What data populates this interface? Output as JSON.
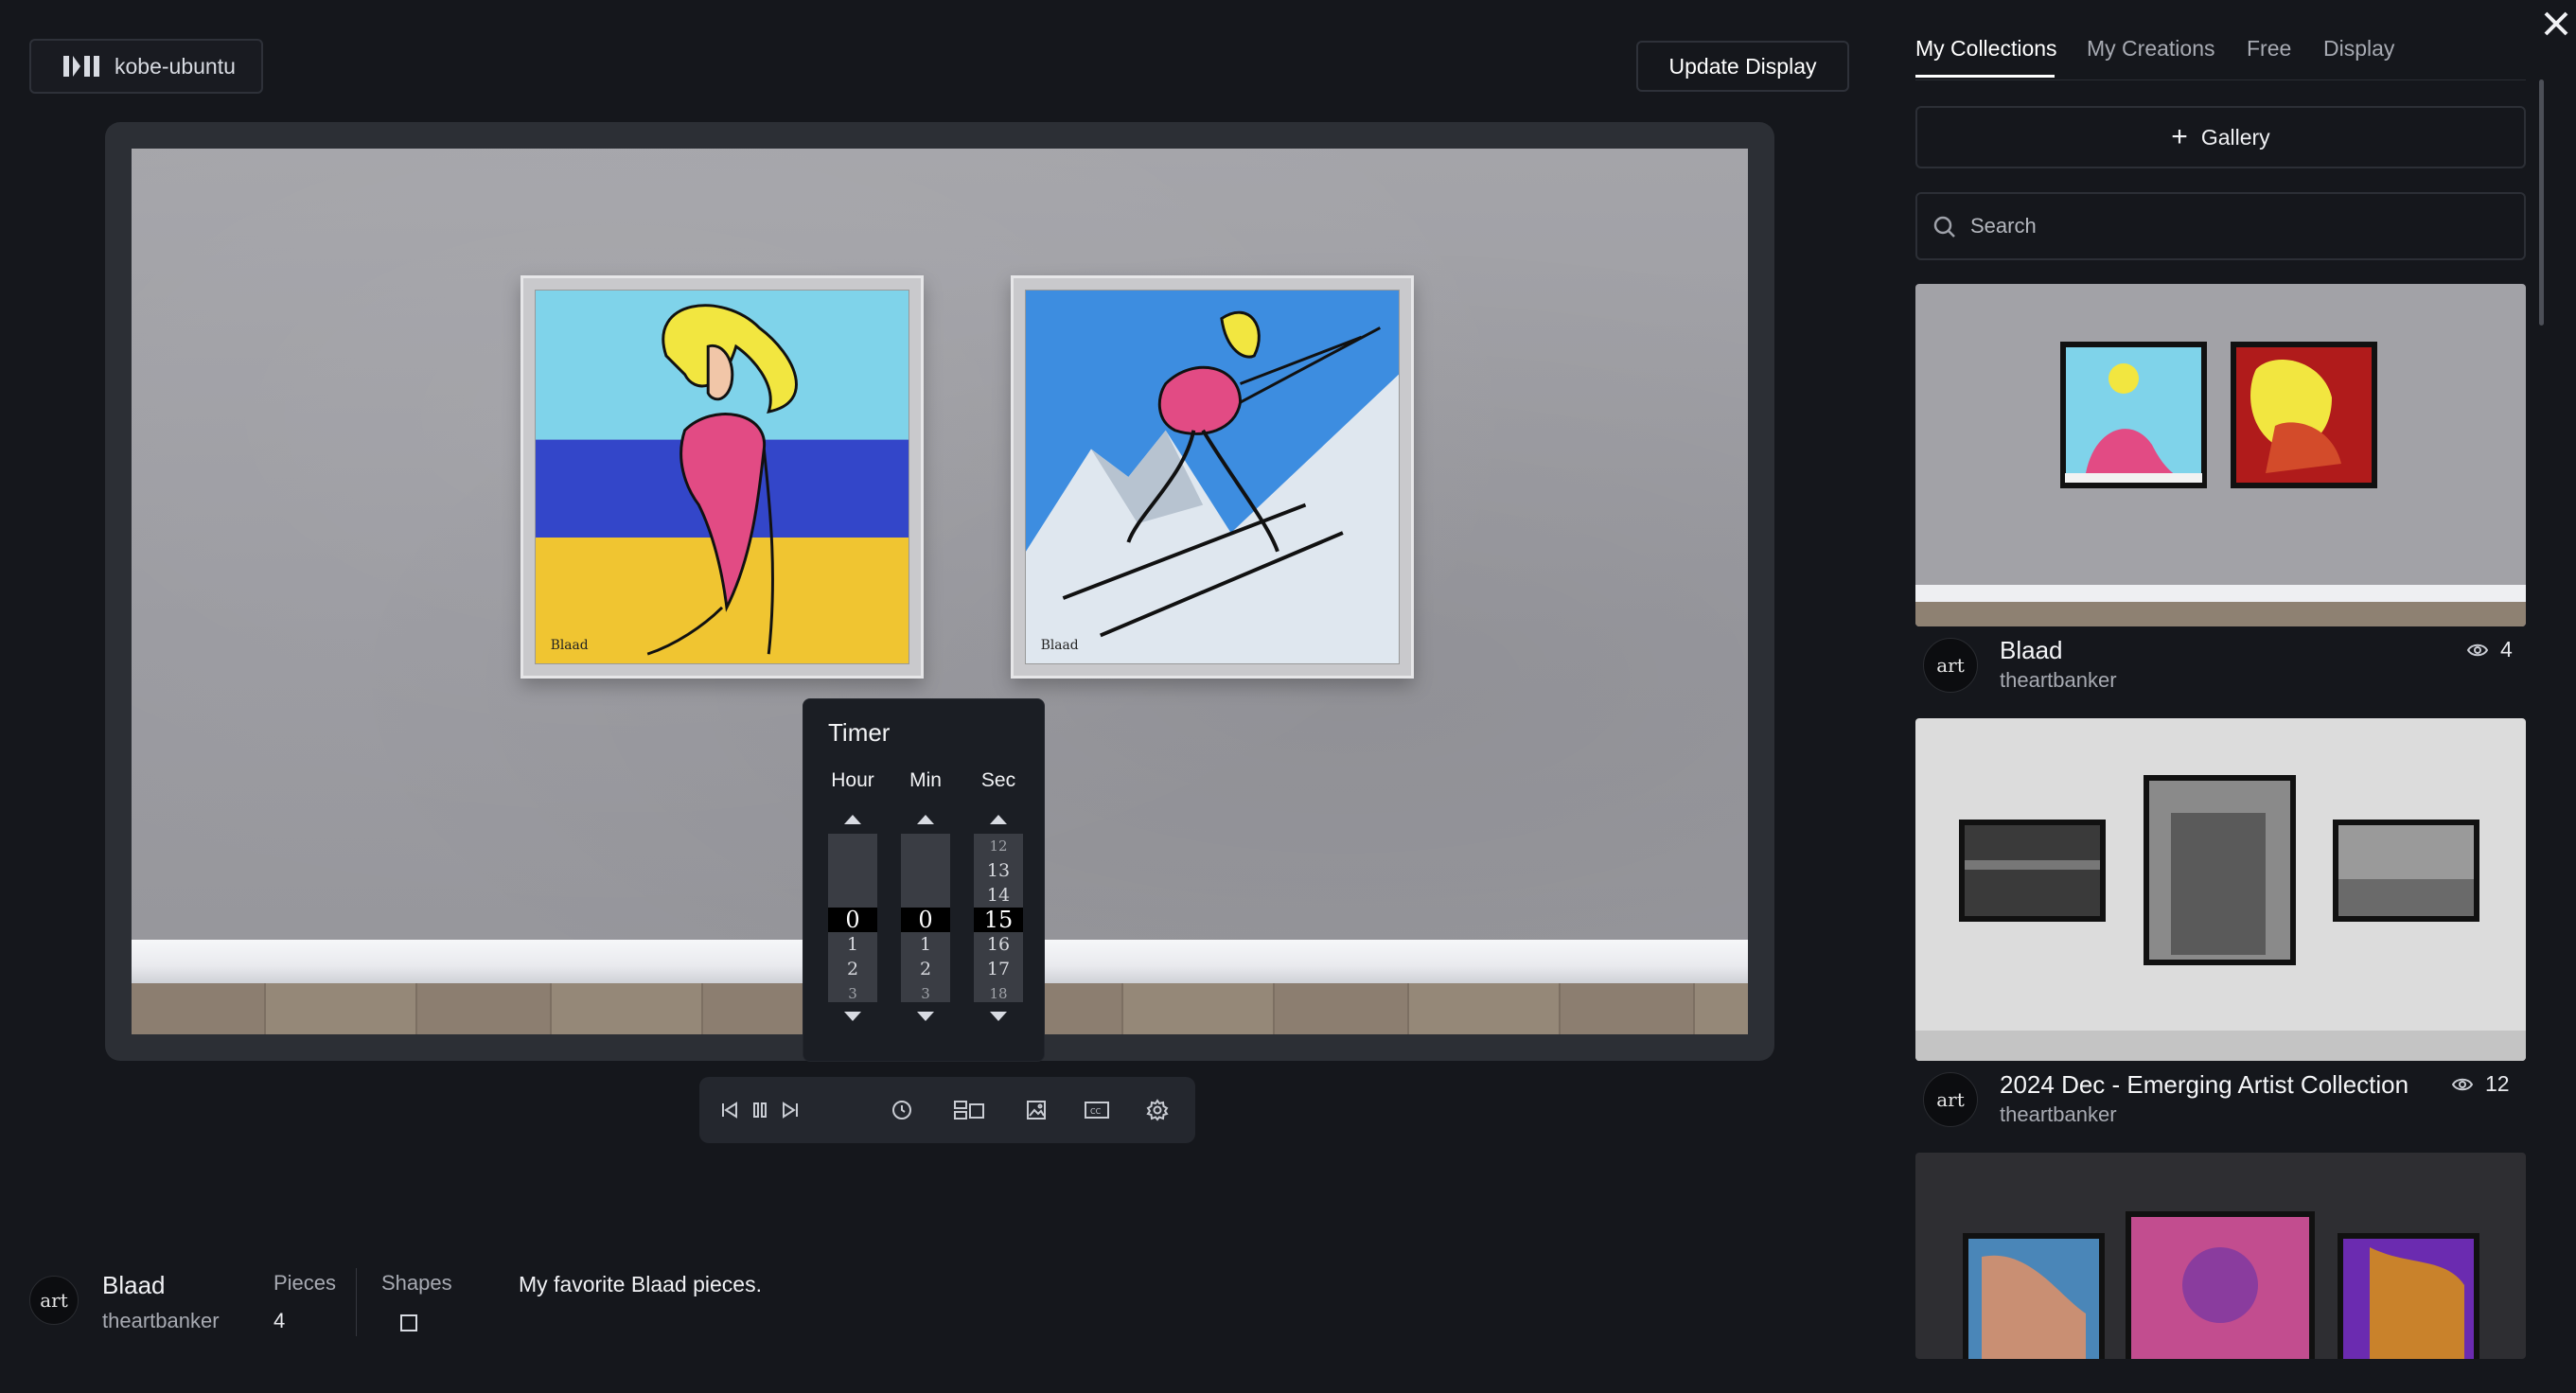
{
  "device": {
    "name": "kobe-ubuntu"
  },
  "toolbar": {
    "update_label": "Update Display"
  },
  "timer": {
    "title": "Timer",
    "hour": {
      "label": "Hour",
      "rows": [
        "",
        "",
        "",
        "0",
        "1",
        "2",
        "3"
      ]
    },
    "min": {
      "label": "Min",
      "rows": [
        "",
        "",
        "",
        "0",
        "1",
        "2",
        "3"
      ]
    },
    "sec": {
      "label": "Sec",
      "rows": [
        "12",
        "13",
        "14",
        "15",
        "16",
        "17",
        "18"
      ]
    }
  },
  "collection": {
    "name": "Blaad",
    "owner": "theartbanker",
    "pieces_label": "Pieces",
    "pieces": "4",
    "shapes_label": "Shapes",
    "description": "My favorite Blaad pieces.",
    "avatar_text": "art"
  },
  "tabs": [
    "My Collections",
    "My Creations",
    "Free",
    "Display"
  ],
  "active_tab": "My Collections",
  "gallery_label": "Gallery",
  "search": {
    "placeholder": "Search",
    "value": ""
  },
  "cards": [
    {
      "title": "Blaad",
      "owner": "theartbanker",
      "count": "4"
    },
    {
      "title": "2024 Dec - Emerging Artist Collection",
      "owner": "theartbanker",
      "count": "12"
    }
  ],
  "colors": {
    "background": "#15171c",
    "panel": "#24272e",
    "wall": "#a0a0a5",
    "accent": "#ffffff"
  },
  "icons": [
    "skip-back-icon",
    "pause-icon",
    "skip-forward-icon",
    "clock-icon",
    "layout-icon",
    "image-icon",
    "cc-icon",
    "gear-icon",
    "close-icon",
    "plus-icon",
    "search-icon",
    "eye-icon"
  ]
}
